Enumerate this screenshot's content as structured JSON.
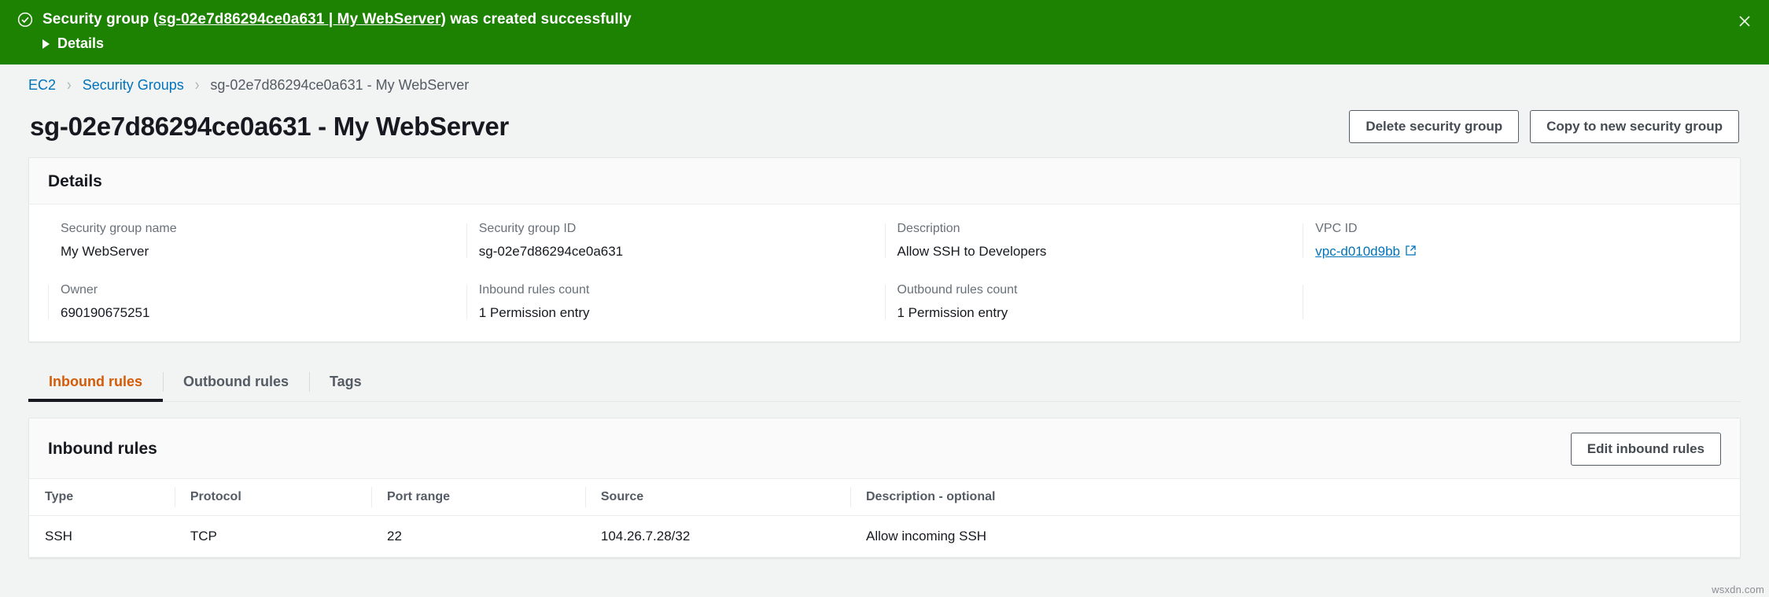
{
  "flash": {
    "icon": "check-circle-icon",
    "message_prefix": "Security group (",
    "link_text": "sg-02e7d86294ce0a631 | My WebServer",
    "message_suffix": ") was created successfully",
    "details_label": "Details",
    "close_icon": "close-icon",
    "background": "#1d8102"
  },
  "breadcrumb": {
    "items": [
      {
        "label": "EC2",
        "link": true
      },
      {
        "label": "Security Groups",
        "link": true
      },
      {
        "label": "sg-02e7d86294ce0a631 - My WebServer",
        "link": false
      }
    ],
    "separator": "›"
  },
  "header": {
    "title": "sg-02e7d86294ce0a631 - My WebServer",
    "delete_button": "Delete security group",
    "copy_button": "Copy to new security group"
  },
  "details": {
    "title": "Details",
    "fields": [
      {
        "label": "Security group name",
        "value": "My WebServer",
        "link": false
      },
      {
        "label": "Security group ID",
        "value": "sg-02e7d86294ce0a631",
        "link": false
      },
      {
        "label": "Description",
        "value": "Allow SSH to Developers",
        "link": false
      },
      {
        "label": "VPC ID",
        "value": "vpc-d010d9bb",
        "link": true
      },
      {
        "label": "Owner",
        "value": "690190675251",
        "link": false
      },
      {
        "label": "Inbound rules count",
        "value": "1 Permission entry",
        "link": false
      },
      {
        "label": "Outbound rules count",
        "value": "1 Permission entry",
        "link": false
      }
    ]
  },
  "tabs": [
    {
      "label": "Inbound rules",
      "active": true
    },
    {
      "label": "Outbound rules",
      "active": false
    },
    {
      "label": "Tags",
      "active": false
    }
  ],
  "rules": {
    "title": "Inbound rules",
    "edit_button": "Edit inbound rules",
    "columns": [
      "Type",
      "Protocol",
      "Port range",
      "Source",
      "Description - optional"
    ],
    "rows": [
      {
        "type": "SSH",
        "protocol": "TCP",
        "port_range": "22",
        "source": "104.26.7.28/32",
        "description": "Allow incoming SSH"
      }
    ]
  },
  "watermark": "wsxdn.com",
  "colors": {
    "success_green": "#1d8102",
    "link_blue": "#0073bb",
    "active_tab_orange": "#d45b07",
    "page_background": "#f2f3f3"
  }
}
